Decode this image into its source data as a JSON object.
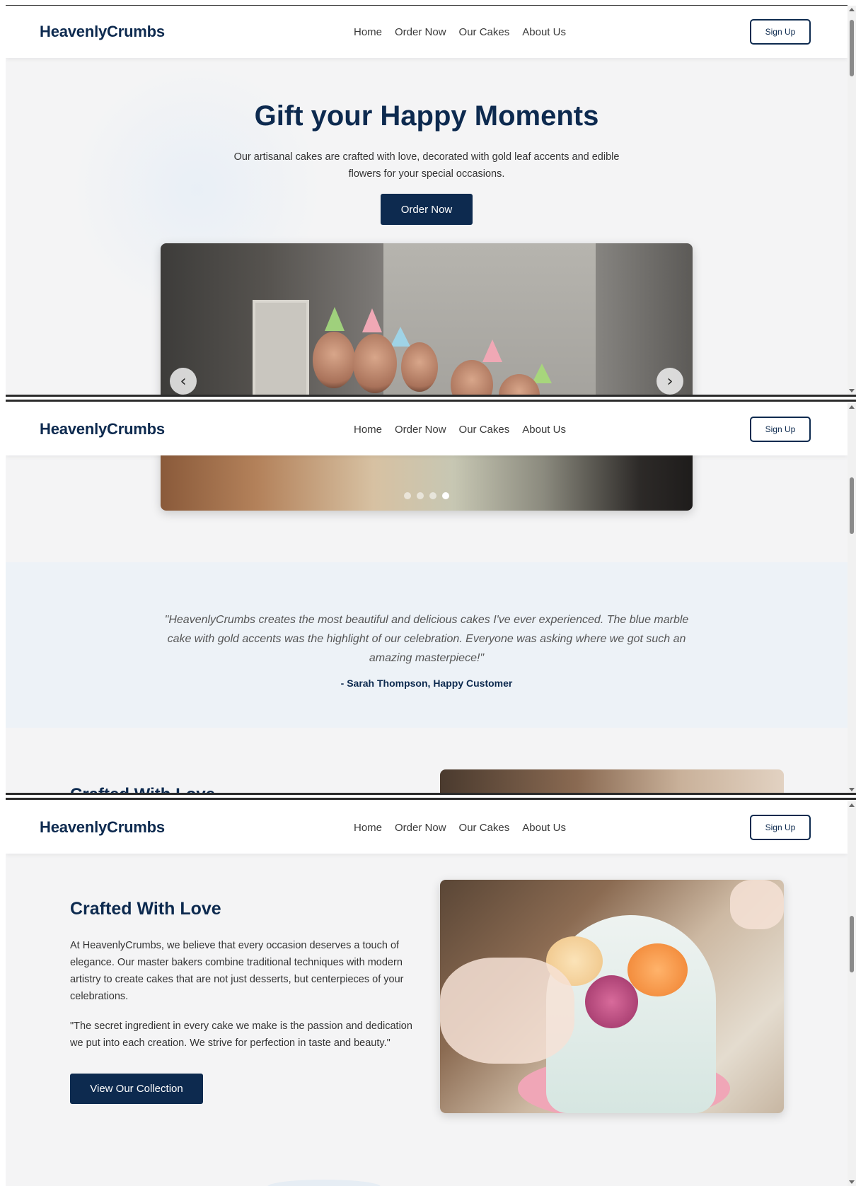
{
  "navbar": {
    "brand": "HeavenlyCrumbs",
    "links": [
      "Home",
      "Order Now",
      "Our Cakes",
      "About Us"
    ],
    "signup_label": "Sign Up"
  },
  "hero": {
    "title": "Gift your Happy Moments",
    "subtitle": "Our artisanal cakes are crafted with love, decorated with gold leaf accents and edible flowers for your special occasions.",
    "button_label": "Order Now"
  },
  "carousel": {
    "prev_icon": "‹",
    "next_icon": "›",
    "slide_count": 4,
    "active_index": 3
  },
  "testimonial": {
    "quote": "\"HeavenlyCrumbs creates the most beautiful and delicious cakes I've ever experienced. The blue marble cake with gold accents was the highlight of our celebration. Everyone was asking where we got such an amazing masterpiece!\"",
    "author": "- Sarah Thompson, Happy Customer"
  },
  "about": {
    "title": "Crafted With Love",
    "paragraph1": "At HeavenlyCrumbs, we believe that every occasion deserves a touch of elegance. Our master bakers combine traditional techniques with modern artistry to create cakes that are not just desserts, but centerpieces of your celebrations.",
    "paragraph2": "\"The secret ingredient in every cake we make is the passion and dedication we put into each creation. We strive for perfection in taste and beauty.\"",
    "button_label": "View Our Collection"
  },
  "colors": {
    "brand_navy": "#0d2a4f",
    "page_background": "#f4f4f5",
    "testimonial_background": "#edf2f7"
  }
}
